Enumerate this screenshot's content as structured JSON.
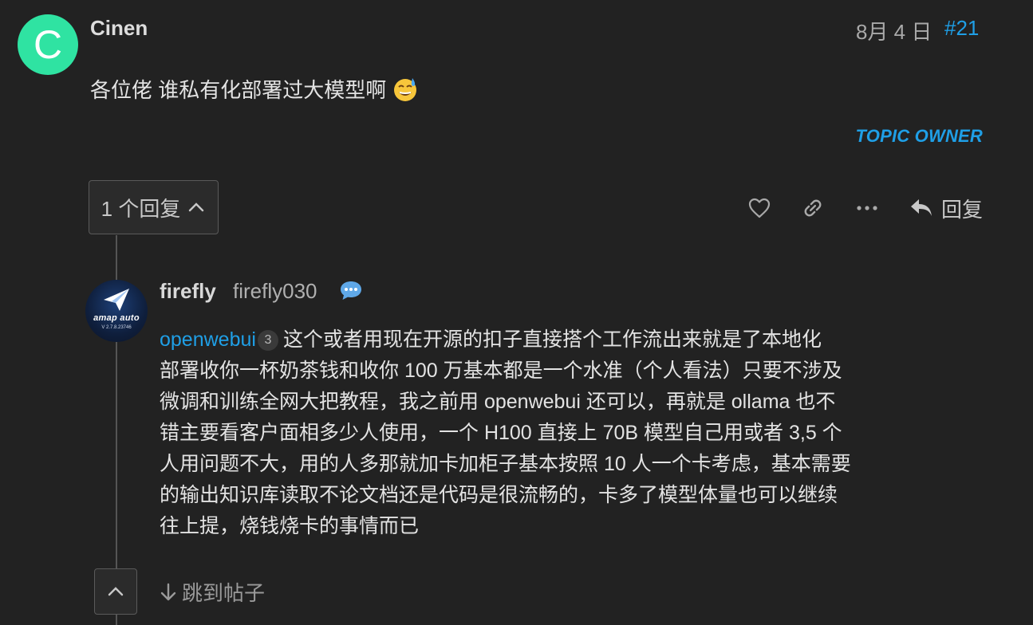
{
  "post": {
    "avatar_letter": "C",
    "avatar_color": "#2fe3a2",
    "username": "Cinen",
    "date": "8月 4 日",
    "post_number": "#21",
    "body": "各位佬 谁私有化部署过大模型啊",
    "emoji": "sweat-smile-emoji",
    "topic_owner_label": "TOPIC OWNER"
  },
  "replies_toggle": {
    "label": "1 个回复"
  },
  "actions": {
    "like_icon": "heart-icon",
    "link_icon": "link-icon",
    "more_icon": "ellipsis-icon",
    "reply_label": "回复"
  },
  "reply": {
    "display_name": "firefly",
    "username": "firefly030",
    "avatar_brand": "amap auto",
    "avatar_version": "V 2.7.8.23746",
    "mention": "openwebui",
    "mention_badge": "3",
    "lines": [
      "这个或者用现在开源的扣子直接搭个工作流出来就是了本地化",
      "部署收你一杯奶茶钱和收你 100 万基本都是一个水准（个人看法）只要不涉及",
      "微调和训练全网大把教程，我之前用 openwebui 还可以，再就是 ollama 也不",
      "错主要看客户面相多少人使用，一个 H100 直接上 70B 模型自己用或者 3,5 个",
      "人用问题不大，用的人多那就加卡加柜子基本按照 10 人一个卡考虑，基本需要",
      "的输出知识库读取不论文档还是代码是很流畅的，卡多了模型体量也可以继续",
      "往上提，烧钱烧卡的事情而已"
    ]
  },
  "jump": {
    "label": "跳到帖子"
  },
  "colors": {
    "background": "#222222",
    "accent": "#1f9fe6",
    "text": "#dddddd",
    "muted": "#a9a9a9"
  }
}
